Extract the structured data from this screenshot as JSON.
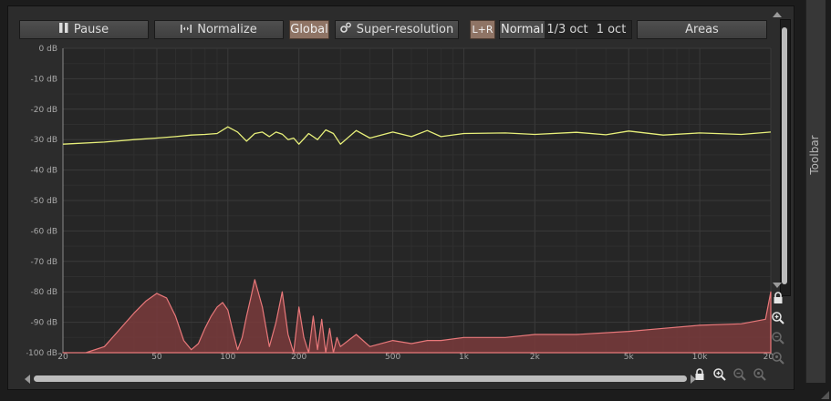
{
  "toolbar_buttons": {
    "pause": "Pause",
    "normalize": "Normalize",
    "global": "Global",
    "super_resolution": "Super-resolution",
    "lr": "L+R",
    "areas": "Areas"
  },
  "resolution": {
    "options": [
      "Normal",
      "1/3 oct",
      "1 oct"
    ],
    "selected": "Normal"
  },
  "side_panel": {
    "label": "Toolbar"
  },
  "colors": {
    "accent": "#8f7465",
    "yellow_curve": "#e8f07a",
    "red_fill": "#7a3b3c",
    "red_line": "#e8787a"
  },
  "chart_data": {
    "type": "area",
    "x_scale": "log",
    "xlim": [
      20,
      20000
    ],
    "ylim": [
      -100,
      0
    ],
    "x_ticks": [
      20,
      50,
      100,
      200,
      500,
      1000,
      2000,
      5000,
      10000,
      20000
    ],
    "x_tick_labels": [
      "20",
      "50",
      "100",
      "200",
      "500",
      "1k",
      "2k",
      "5k",
      "10k",
      "20k"
    ],
    "y_ticks": [
      0,
      -10,
      -20,
      -30,
      -40,
      -50,
      -60,
      -70,
      -80,
      -90,
      -100
    ],
    "y_tick_labels": [
      "0 dB",
      "-10 dB",
      "-20 dB",
      "-30 dB",
      "-40 dB",
      "-50 dB",
      "-60 dB",
      "-70 dB",
      "-80 dB",
      "-90 dB",
      "-100 dB"
    ],
    "grid": true,
    "series": [
      {
        "color": "#e8f07a",
        "x": [
          20,
          30,
          40,
          50,
          60,
          70,
          80,
          90,
          100,
          110,
          120,
          130,
          140,
          150,
          160,
          170,
          180,
          190,
          200,
          220,
          240,
          260,
          280,
          300,
          350,
          400,
          500,
          600,
          700,
          800,
          1000,
          1500,
          2000,
          3000,
          4000,
          5000,
          7000,
          10000,
          15000,
          20000
        ],
        "y": [
          -31.5,
          -30.8,
          -30,
          -29.5,
          -29,
          -28.5,
          -28.3,
          -28,
          -25.8,
          -27.5,
          -30.5,
          -28,
          -27.5,
          -29,
          -27.5,
          -28.2,
          -30,
          -29.5,
          -31.5,
          -28,
          -30,
          -26.8,
          -28,
          -31.5,
          -27,
          -29.5,
          -27.5,
          -29,
          -27,
          -29,
          -28,
          -27.8,
          -28.3,
          -27.6,
          -28.4,
          -27.2,
          -28.5,
          -27.8,
          -28.3,
          -27.5
        ]
      },
      {
        "color": "#e8787a",
        "x": [
          20,
          25,
          30,
          40,
          45,
          50,
          55,
          60,
          65,
          70,
          75,
          80,
          85,
          90,
          95,
          100,
          105,
          110,
          115,
          120,
          125,
          130,
          140,
          150,
          160,
          170,
          180,
          190,
          200,
          210,
          220,
          230,
          240,
          250,
          260,
          270,
          280,
          290,
          300,
          350,
          400,
          500,
          600,
          700,
          800,
          1000,
          1500,
          2000,
          3000,
          5000,
          7000,
          10000,
          15000,
          19000,
          20000
        ],
        "y": [
          -100,
          -100,
          -98,
          -87,
          -83,
          -80.5,
          -82,
          -88,
          -96,
          -99,
          -97,
          -92,
          -88,
          -85,
          -83.5,
          -86,
          -93,
          -99,
          -95,
          -88,
          -82,
          -76,
          -85,
          -98,
          -90,
          -80,
          -94,
          -100,
          -85,
          -95,
          -100,
          -88,
          -99,
          -89,
          -100,
          -92,
          -100,
          -95,
          -98,
          -94,
          -98,
          -96,
          -97,
          -96,
          -96,
          -95,
          -95,
          -94,
          -94,
          -93,
          -92,
          -91,
          -90.5,
          -89,
          -80
        ]
      }
    ]
  }
}
